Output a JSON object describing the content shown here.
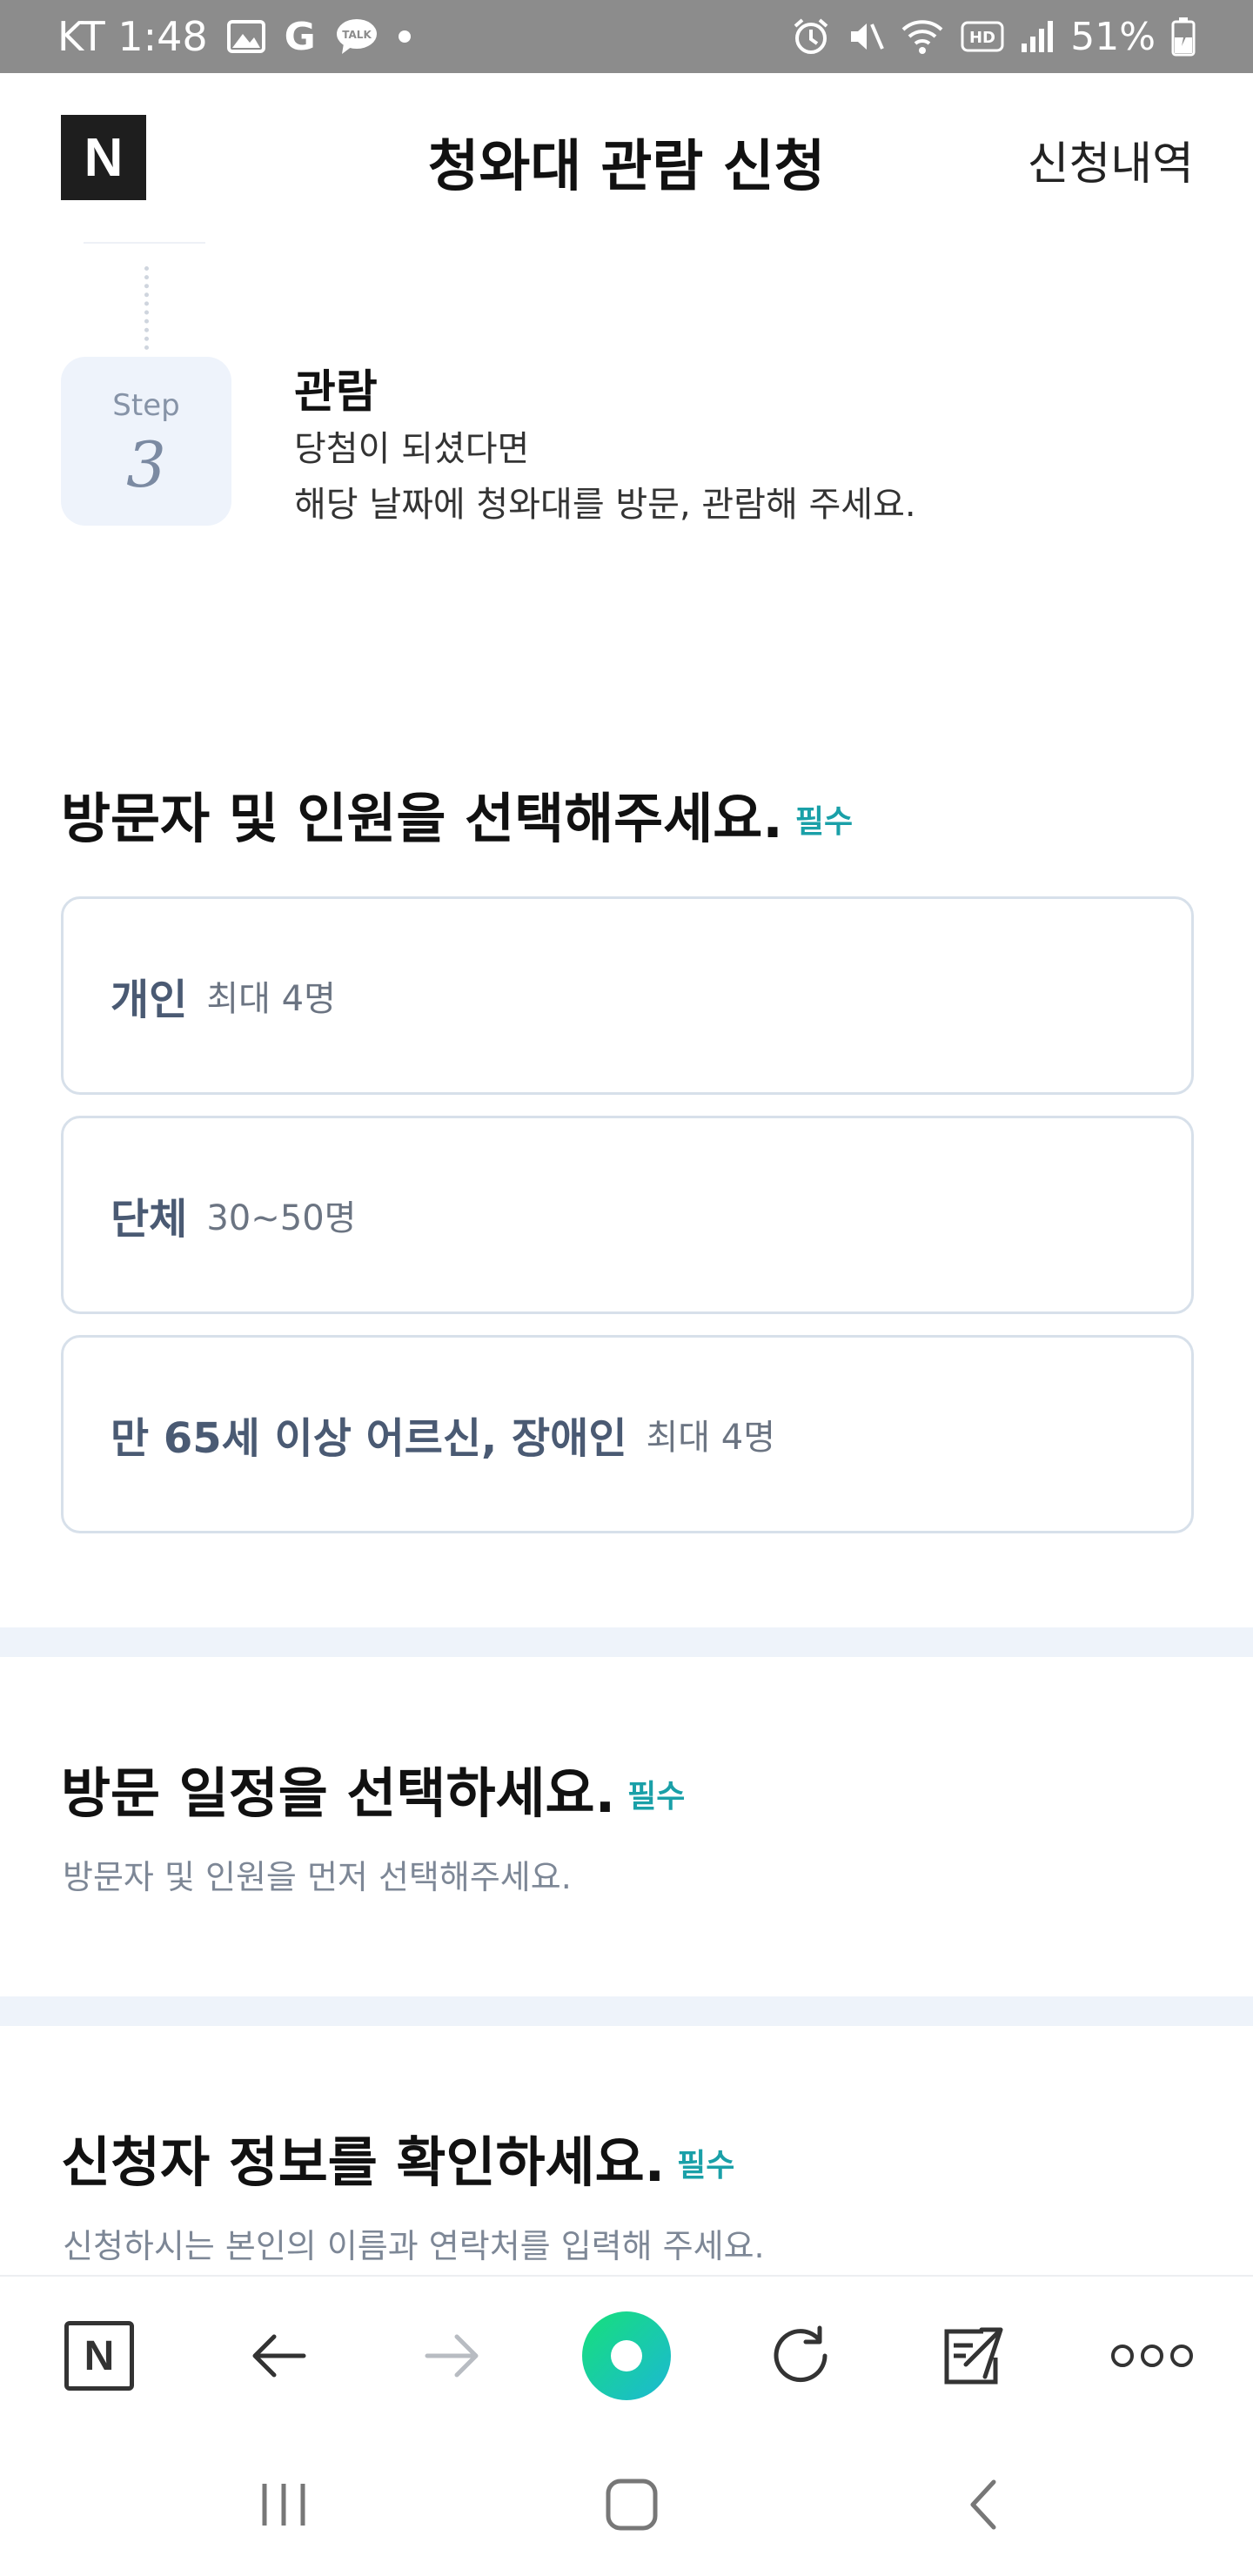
{
  "status_bar": {
    "carrier_time": "KT 1:48",
    "battery": "51%",
    "icons": [
      "gallery-icon",
      "google-icon",
      "talk-icon",
      "dot-icon",
      "alarm-icon",
      "mute-icon",
      "wifi-icon",
      "hd-icon",
      "signal-icon",
      "battery-icon"
    ],
    "talk_label": "TALK",
    "hd_label": "HD"
  },
  "header": {
    "logo": "N",
    "title": "청와대 관람 신청",
    "history_link": "신청내역"
  },
  "step": {
    "word": "Step",
    "number": "3",
    "title": "관람",
    "desc_line1": "당첨이 되셨다면",
    "desc_line2": "해당 날짜에 청와대를 방문, 관람해 주세요."
  },
  "visitor_section": {
    "title": "방문자 및 인원을 선택해주세요.",
    "required": "필수",
    "options": [
      {
        "label": "개인",
        "sub": "최대 4명"
      },
      {
        "label": "단체",
        "sub": "30~50명"
      },
      {
        "label": "만 65세 이상 어르신, 장애인",
        "sub": "최대 4명"
      }
    ]
  },
  "schedule_section": {
    "title": "방문 일정을 선택하세요.",
    "required": "필수",
    "subtitle": "방문자 및 인원을 먼저 선택해주세요."
  },
  "applicant_section": {
    "title": "신청자 정보를 확인하세요.",
    "required": "필수",
    "subtitle": "신청하시는 본인의 이름과 연락처를 입력해 주세요."
  },
  "toolbar": {
    "home_logo": "N",
    "icons": [
      "naver-home-icon",
      "back-arrow-icon",
      "forward-arrow-icon",
      "green-dot-icon",
      "refresh-icon",
      "share-icon",
      "more-icon"
    ]
  },
  "navbar": {
    "icons": [
      "recent-apps-icon",
      "home-icon",
      "back-icon"
    ]
  },
  "colors": {
    "accent": "#1aa0a8",
    "card_text": "#4a5a73",
    "status_bar": "#8c8c8c"
  }
}
